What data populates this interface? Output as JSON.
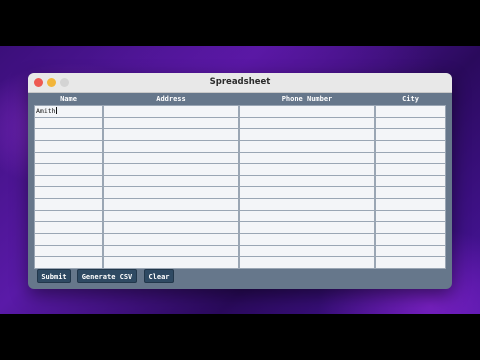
{
  "window": {
    "title": "Spreadsheet"
  },
  "table": {
    "columns": [
      "Name",
      "Address",
      "Phone Number",
      "City"
    ],
    "rows": 14,
    "cells": [
      [
        "Amith",
        "",
        "",
        ""
      ]
    ]
  },
  "buttons": {
    "submit": "Submit",
    "generate_csv": "Generate CSV",
    "clear": "Clear"
  }
}
